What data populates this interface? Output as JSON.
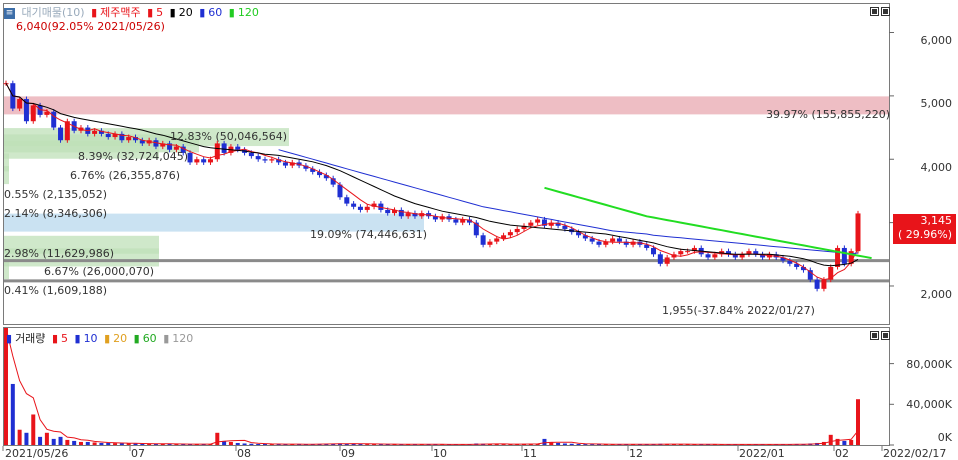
{
  "legend": {
    "icon": "memo-icon",
    "chart_name": "대기매물(10)",
    "stock_name": "제주맥주",
    "ma_labels": [
      "5",
      "20",
      "60",
      "120"
    ],
    "ma_colors": [
      "#e8141a",
      "#000000",
      "#1f2fd2",
      "#22cc22"
    ]
  },
  "max_label": "6,040(92.05% 2021/05/26)",
  "min_label": "1,955(-37.84% 2022/01/27)",
  "price_tag": {
    "value": "3,145",
    "change": "( 29.96%)"
  },
  "price_axis": [
    "6,000",
    "5,000",
    "4,000",
    "3,000",
    "2,000"
  ],
  "volume_legend": {
    "title": "거래량",
    "ma_labels": [
      "5",
      "10",
      "20",
      "60",
      "120"
    ],
    "ma_colors": [
      "#e8141a",
      "#1f2fd2",
      "#e0a020",
      "#22aa22",
      "#999999"
    ]
  },
  "volume_axis": [
    "80,000K",
    "40,000K",
    "0K"
  ],
  "x_axis": [
    "2021/05/26",
    "07",
    "08",
    "09",
    "10",
    "11",
    "12",
    "2022/01",
    "02",
    "2022/02/17"
  ],
  "bands": [
    {
      "label": "39.97% (155,855,220)",
      "color": "#e8a8b0",
      "price": 4850
    },
    {
      "label": "12.83% (50,046,564)",
      "color": "#bfe0b8",
      "price": 4350
    },
    {
      "label": "8.39% (32,724,045)",
      "color": "#bfe0b8",
      "price": 4250
    },
    {
      "label": "6.76% (26,355,876)",
      "color": "#bfe0b8",
      "price": 4150
    },
    {
      "label": "0.55% (2,135,052)",
      "color": "#bfe0b8",
      "price": 3950
    },
    {
      "label": "2.14% (8,346,306)",
      "color": "#bfe0b8",
      "price": 3750
    },
    {
      "label": "19.09% (74,446,631)",
      "color": "#b8d8ee",
      "price": 3000
    },
    {
      "label": "2.98% (11,629,986)",
      "color": "#bfe0b8",
      "price": 2650
    },
    {
      "label": "6.67% (26,000,070)",
      "color": "#bfe0b8",
      "price": 2450
    },
    {
      "label": "0.41% (1,609,188)",
      "color": "#bfe0b8",
      "price": 2250
    }
  ],
  "chart_data": {
    "type": "candlestick",
    "price_range": [
      1400,
      6450
    ],
    "volume_range": [
      0,
      115000
    ],
    "close": [
      5200,
      4800,
      4950,
      4600,
      4850,
      4700,
      4750,
      4500,
      4300,
      4600,
      4450,
      4500,
      4400,
      4450,
      4400,
      4350,
      4400,
      4300,
      4350,
      4300,
      4250,
      4300,
      4200,
      4250,
      4150,
      4200,
      4100,
      3950,
      4000,
      3950,
      4000,
      4250,
      4100,
      4200,
      4150,
      4100,
      4050,
      4000,
      3980,
      4000,
      3950,
      3900,
      3950,
      3900,
      3850,
      3800,
      3750,
      3700,
      3600,
      3400,
      3300,
      3250,
      3200,
      3250,
      3300,
      3200,
      3150,
      3200,
      3100,
      3150,
      3100,
      3150,
      3100,
      3050,
      3100,
      3050,
      3000,
      3050,
      3000,
      2800,
      2650,
      2700,
      2750,
      2800,
      2850,
      2900,
      2950,
      3000,
      3050,
      2950,
      3000,
      2950,
      2900,
      2850,
      2800,
      2750,
      2700,
      2650,
      2700,
      2750,
      2700,
      2650,
      2700,
      2650,
      2600,
      2500,
      2350,
      2450,
      2500,
      2550,
      2550,
      2600,
      2500,
      2450,
      2500,
      2550,
      2500,
      2450,
      2500,
      2550,
      2500,
      2450,
      2500,
      2450,
      2400,
      2350,
      2300,
      2250,
      2100,
      1955,
      2100,
      2300,
      2600,
      2350,
      2550,
      3145
    ],
    "ma5": [
      5200,
      5000,
      4983,
      4888,
      4880,
      4780,
      4770,
      4680,
      4620,
      4570,
      4520,
      4470,
      4450,
      4480,
      4440,
      4420,
      4400,
      4380,
      4370,
      4340,
      4300,
      4280,
      4260,
      4240,
      4230,
      4220,
      4170,
      4120,
      4080,
      4040,
      4020,
      4060,
      4080,
      4120,
      4140,
      4160,
      4120,
      4100,
      4060,
      4030,
      3990,
      3960,
      3940,
      3920,
      3890,
      3850,
      3800,
      3750,
      3680,
      3600,
      3520,
      3440,
      3360,
      3290,
      3260,
      3240,
      3220,
      3200,
      3170,
      3160,
      3140,
      3130,
      3120,
      3100,
      3080,
      3070,
      3060,
      3050,
      3040,
      2980,
      2900,
      2840,
      2780,
      2740,
      2760,
      2800,
      2860,
      2920,
      2950,
      2970,
      2990,
      2990,
      2960,
      2920,
      2860,
      2800,
      2760,
      2720,
      2700,
      2690,
      2690,
      2690,
      2680,
      2680,
      2660,
      2620,
      2560,
      2520,
      2480,
      2470,
      2490,
      2530,
      2540,
      2530,
      2520,
      2510,
      2500,
      2490,
      2500,
      2510,
      2500,
      2490,
      2480,
      2470,
      2450,
      2410,
      2360,
      2300,
      2220,
      2140,
      2100,
      2120,
      2210,
      2260,
      2380,
      2590
    ],
    "ma20": [
      5200,
      5000,
      4983,
      4888,
      4880,
      4850,
      4820,
      4780,
      4720,
      4690,
      4660,
      4640,
      4620,
      4600,
      4580,
      4560,
      4540,
      4520,
      4500,
      4480,
      4460,
      4430,
      4400,
      4380,
      4350,
      4320,
      4290,
      4260,
      4230,
      4200,
      4180,
      4170,
      4160,
      4150,
      4140,
      4130,
      4110,
      4100,
      4080,
      4070,
      4060,
      4040,
      4020,
      4000,
      3980,
      3960,
      3930,
      3900,
      3860,
      3820,
      3770,
      3720,
      3670,
      3620,
      3570,
      3520,
      3470,
      3420,
      3380,
      3340,
      3300,
      3270,
      3240,
      3210,
      3180,
      3160,
      3140,
      3120,
      3100,
      3080,
      3050,
      3020,
      3000,
      2980,
      2960,
      2950,
      2940,
      2930,
      2920,
      2910,
      2900,
      2890,
      2880,
      2870,
      2860,
      2850,
      2840,
      2830,
      2820,
      2800,
      2780,
      2760,
      2740,
      2720,
      2700,
      2680,
      2650,
      2620,
      2600,
      2580,
      2570,
      2560,
      2550,
      2540,
      2530,
      2520,
      2510,
      2500,
      2500,
      2500,
      2500,
      2500,
      2500,
      2490,
      2480,
      2470,
      2450,
      2430,
      2400,
      2360,
      2330,
      2320,
      2330,
      2340,
      2360,
      2420
    ],
    "ma60": [
      null,
      null,
      null,
      null,
      null,
      null,
      null,
      null,
      null,
      null,
      null,
      null,
      null,
      null,
      null,
      null,
      null,
      null,
      null,
      null,
      null,
      null,
      null,
      null,
      null,
      null,
      null,
      null,
      null,
      null,
      null,
      null,
      null,
      null,
      null,
      null,
      null,
      null,
      null,
      null,
      4150,
      4120,
      4090,
      4060,
      4030,
      4000,
      3970,
      3940,
      3910,
      3880,
      3850,
      3820,
      3790,
      3760,
      3730,
      3700,
      3670,
      3640,
      3610,
      3580,
      3550,
      3520,
      3490,
      3460,
      3430,
      3400,
      3370,
      3340,
      3310,
      3280,
      3250,
      3230,
      3210,
      3190,
      3170,
      3150,
      3130,
      3110,
      3090,
      3070,
      3050,
      3030,
      3010,
      2990,
      2970,
      2950,
      2930,
      2910,
      2890,
      2870,
      2860,
      2850,
      2840,
      2830,
      2820,
      2800,
      2790,
      2780,
      2770,
      2760,
      2750,
      2740,
      2730,
      2720,
      2710,
      2700,
      2690,
      2680,
      2670,
      2660,
      2650,
      2640,
      2630,
      2620,
      2610,
      2600,
      2590,
      2580,
      2570,
      2560,
      2550,
      2540,
      2530,
      2520,
      2510,
      2520
    ],
    "ma120_start_index": 79,
    "ma120": [
      3550,
      3520,
      3490,
      3460,
      3430,
      3400,
      3370,
      3340,
      3310,
      3280,
      3250,
      3220,
      3190,
      3160,
      3130,
      3100,
      3080,
      3060,
      3040,
      3020,
      3000,
      2980,
      2960,
      2940,
      2920,
      2900,
      2880,
      2860,
      2840,
      2820,
      2800,
      2780,
      2760,
      2740,
      2720,
      2700,
      2680,
      2660,
      2640,
      2620,
      2600,
      2580,
      2560,
      2540,
      2520,
      2500,
      2480,
      2460,
      2440
    ],
    "volume": [
      115000,
      60000,
      15000,
      12000,
      30000,
      8000,
      12000,
      6000,
      8000,
      5000,
      4000,
      3000,
      3000,
      2500,
      2000,
      2000,
      1800,
      1600,
      1500,
      1400,
      1300,
      1200,
      1200,
      1000,
      1000,
      900,
      900,
      800,
      800,
      800,
      900,
      12000,
      4000,
      3000,
      2000,
      1500,
      1200,
      1000,
      1000,
      900,
      900,
      800,
      800,
      800,
      800,
      900,
      1000,
      1200,
      1400,
      1600,
      1400,
      1200,
      1000,
      900,
      900,
      800,
      800,
      800,
      700,
      700,
      700,
      700,
      600,
      600,
      600,
      600,
      600,
      600,
      600,
      1500,
      1200,
      1000,
      900,
      800,
      700,
      1000,
      1200,
      1300,
      1100,
      6000,
      3000,
      2000,
      1500,
      1200,
      1000,
      900,
      800,
      800,
      700,
      700,
      700,
      700,
      600,
      600,
      700,
      800,
      1200,
      1000,
      800,
      700,
      700,
      700,
      600,
      600,
      600,
      600,
      600,
      600,
      600,
      600,
      600,
      600,
      600,
      600,
      600,
      700,
      800,
      900,
      1500,
      2000,
      3000,
      10000,
      6000,
      4000,
      5000,
      45000
    ]
  }
}
